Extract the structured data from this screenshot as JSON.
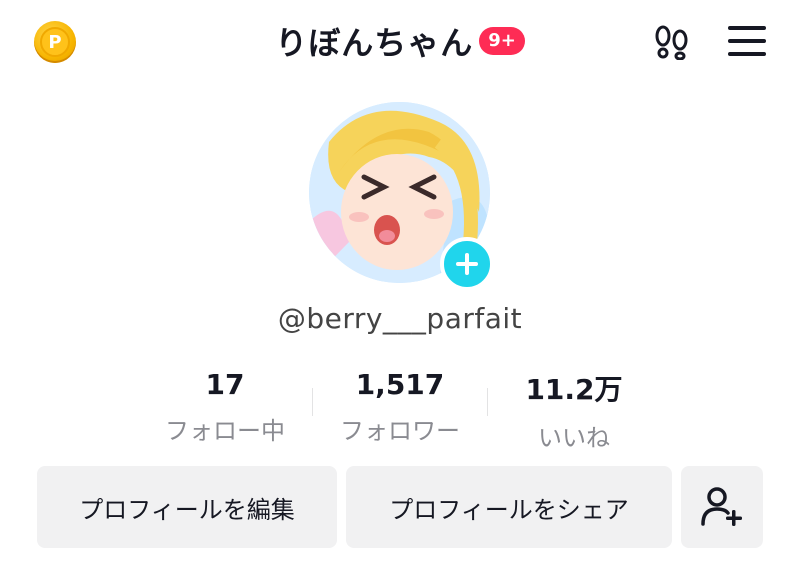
{
  "header": {
    "coin_letter": "P",
    "title": "りぼんちゃん",
    "badge": "9+"
  },
  "profile": {
    "username": "@berry___parfait"
  },
  "stats": [
    {
      "value": "17",
      "label": "フォロー中"
    },
    {
      "value": "1,517",
      "label": "フォロワー"
    },
    {
      "value": "11.2万",
      "label": "いいね"
    }
  ],
  "actions": {
    "edit_profile": "プロフィールを編集",
    "share_profile": "プロフィールをシェア"
  },
  "colors": {
    "accent_badge": "#fe2c55",
    "add_button": "#20d5ec",
    "button_bg": "#f1f1f2"
  }
}
